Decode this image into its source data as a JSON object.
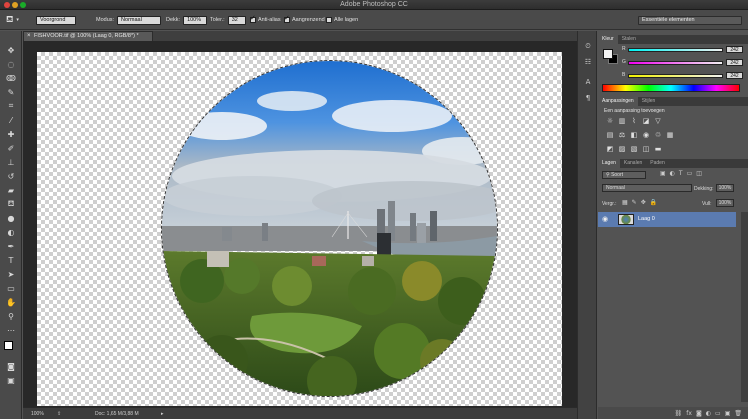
{
  "app": {
    "title": "Adobe Photoshop CC"
  },
  "options_bar": {
    "brush_preset": "Voorgrond",
    "mode_label": "Modus:",
    "mode_value": "Normaal",
    "opacity_label": "Dekk:",
    "opacity_value": "100%",
    "tolerance_label": "Toler.:",
    "tolerance_value": "32",
    "antialias_label": "Anti-alias",
    "contiguous_label": "Aangrenzend",
    "all_layers_label": "Alle lagen",
    "workspace": "Essentiële elementen"
  },
  "document": {
    "tab_title": "FISHVOOR.tif @ 100% (Laag 0, RGB/8*) *",
    "status_zoom": "100%",
    "status_doc": "Doc: 1,65 M/3,88 M"
  },
  "color_panel": {
    "tabs": [
      "Kleur",
      "Stalen"
    ],
    "rows": [
      {
        "label": "R",
        "value": "242"
      },
      {
        "label": "G",
        "value": "242"
      },
      {
        "label": "B",
        "value": "242"
      }
    ]
  },
  "adjust_panel": {
    "tabs": [
      "Aanpassingen",
      "Stijlen"
    ],
    "heading": "Een aanpassing toevoegen"
  },
  "layers_panel": {
    "tabs": [
      "Lagen",
      "Kanalen",
      "Paden"
    ],
    "filter": "Soort",
    "blend_mode": "Normaal",
    "opacity_label": "Dekking:",
    "opacity_value": "100%",
    "lock_label": "Vergr.:",
    "fill_label": "Vull:",
    "fill_value": "100%",
    "layers": [
      {
        "name": "Laag 0"
      }
    ]
  },
  "colors": {
    "accent": "#5b7bb0",
    "panel_bg": "#535353",
    "canvas_bg": "#282828"
  }
}
